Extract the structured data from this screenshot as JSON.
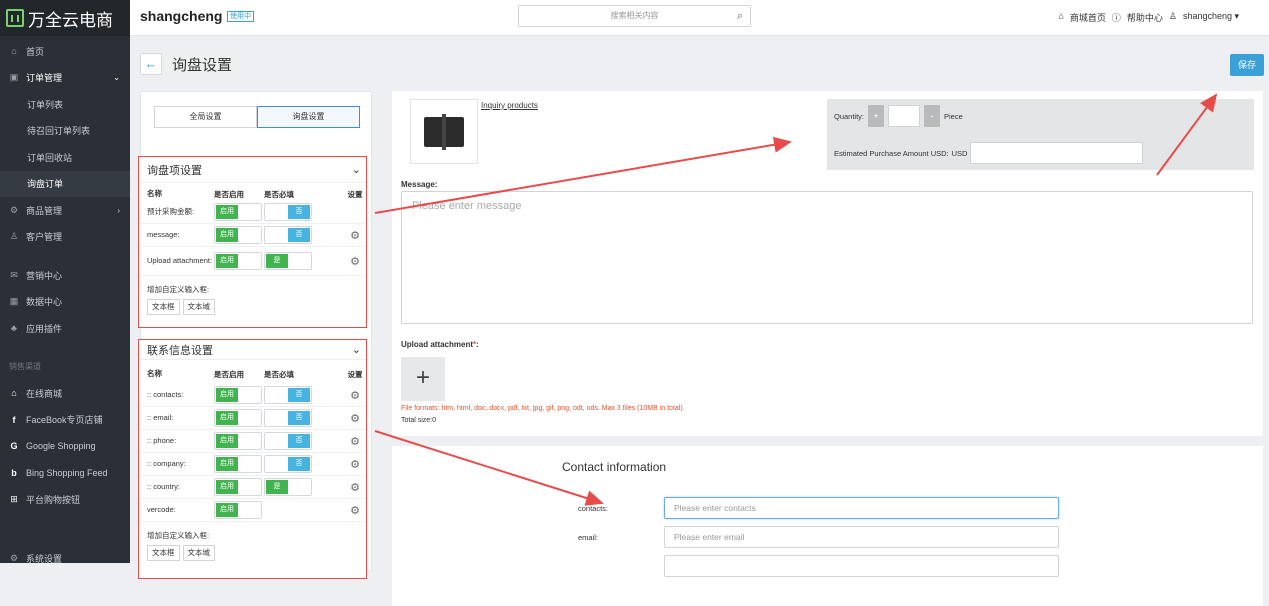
{
  "brand": {
    "logo_text": "万全云电商",
    "shop_name": "shangcheng",
    "shop_badge": "使用中"
  },
  "search": {
    "placeholder": "搜索相关内容"
  },
  "toplinks": {
    "store_home": "商城首页",
    "help": "帮助中心",
    "user": "shangcheng ▾"
  },
  "sidebar": {
    "items": [
      {
        "label": "首页",
        "icon": "home-icon"
      },
      {
        "label": "订单管理",
        "icon": "order-icon"
      },
      {
        "label": "订单列表"
      },
      {
        "label": "待召回订单列表"
      },
      {
        "label": "订单回收站"
      },
      {
        "label": "询盘订单"
      },
      {
        "label": "商品管理",
        "icon": "product-icon"
      },
      {
        "label": "客户管理",
        "icon": "customer-icon"
      },
      {
        "label": "营销中心",
        "icon": "marketing-icon"
      },
      {
        "label": "数据中心",
        "icon": "data-icon"
      },
      {
        "label": "应用插件",
        "icon": "plugin-icon"
      },
      {
        "label": "销售渠道"
      },
      {
        "label": "在线商城",
        "icon": "store-icon"
      },
      {
        "label": "FaceBook专页店铺",
        "icon": "facebook-icon"
      },
      {
        "label": "Google Shopping",
        "icon": "google-icon"
      },
      {
        "label": "Bing Shopping Feed",
        "icon": "bing-icon"
      },
      {
        "label": "平台购物按钮",
        "icon": "cart-button-icon"
      },
      {
        "label": "系统设置",
        "icon": "settings-icon"
      }
    ]
  },
  "page": {
    "title": "询盘设置",
    "save": "保存"
  },
  "tabs": {
    "global": "全局设置",
    "inquiry": "询盘设置"
  },
  "inquiry_items": {
    "title": "询盘项设置",
    "headers": {
      "name": "名称",
      "enabled": "是否启用",
      "required": "是否必填",
      "settings": "设置"
    },
    "rows": [
      {
        "name": "预计采购金额:",
        "enabled": "启用",
        "required": "否"
      },
      {
        "name": "message:",
        "enabled": "启用",
        "required": "否"
      },
      {
        "name": "Upload attachment:",
        "enabled": "启用",
        "required": "是"
      }
    ],
    "add_label": "增加自定义输入框:",
    "add_text": "文本框",
    "add_area": "文本域"
  },
  "contact_items": {
    "title": "联系信息设置",
    "headers": {
      "name": "名称",
      "enabled": "是否启用",
      "required": "是否必填",
      "settings": "设置"
    },
    "rows": [
      {
        "name": ":: contacts:",
        "enabled": "启用",
        "required": "否"
      },
      {
        "name": ":: email:",
        "enabled": "启用",
        "required": "否"
      },
      {
        "name": ":: phone:",
        "enabled": "启用",
        "required": "否"
      },
      {
        "name": ":: company:",
        "enabled": "启用",
        "required": "否"
      },
      {
        "name": ":: country:",
        "enabled": "启用",
        "required": "是"
      },
      {
        "name": "vercode:",
        "enabled": "启用"
      }
    ],
    "add_label": "增加自定义输入框:",
    "add_text": "文本框",
    "add_area": "文本域"
  },
  "preview": {
    "product_link": "Inquiry products",
    "quantity_label": "Quantity:",
    "plus": "+",
    "minus": "-",
    "unit": "Piece",
    "amount_label": "Estimated Purchase Amount USD:",
    "currency": "USD",
    "message_label": "Message:",
    "message_placeholder": "Please enter message",
    "upload_label": "Upload attachment",
    "required_mark": "*",
    "upload_colon": ":",
    "upload_plus": "+",
    "formats": "File formats: htm, html, doc, docx, pdf, txt, jpg, gif, png, odt, ods. Max 3 files (10MB in total).",
    "total": "Total size:0"
  },
  "contact_form": {
    "title": "Contact information",
    "fields": [
      {
        "label": "contacts:",
        "placeholder": "Please enter contacts"
      },
      {
        "label": "email:",
        "placeholder": "Please enter email"
      }
    ]
  },
  "colors": {
    "accent": "#3aa0d6",
    "enabled_green": "#41b34f",
    "toggle_blue": "#46b3e0",
    "annotation_red": "#e94b4b"
  }
}
